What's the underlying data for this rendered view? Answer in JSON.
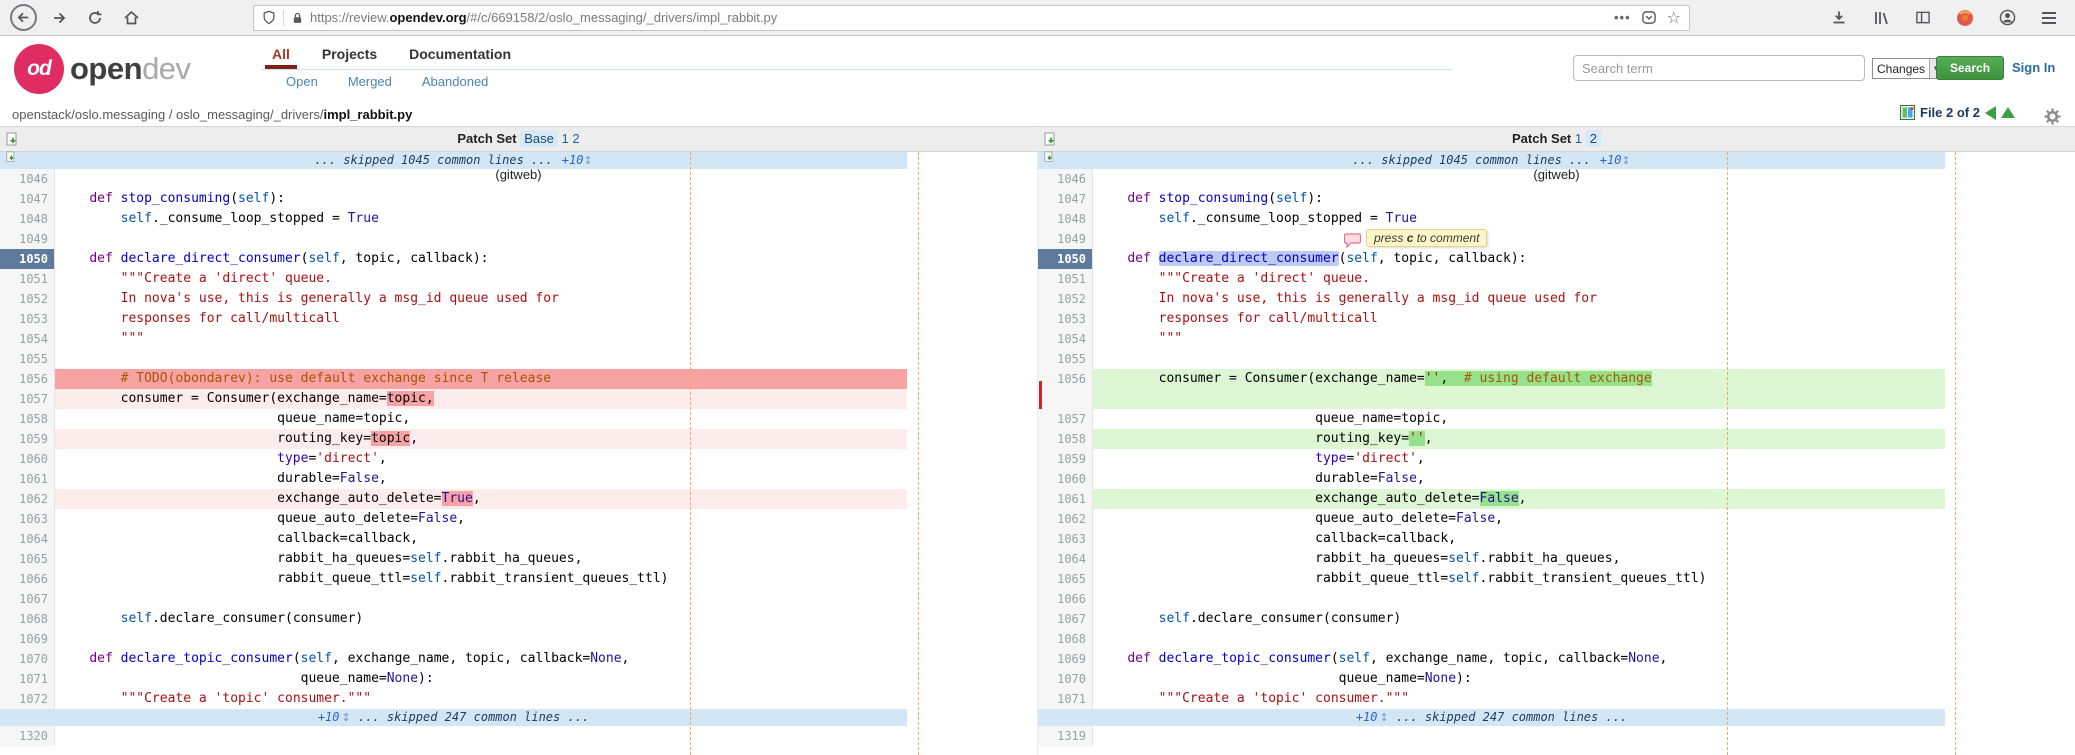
{
  "browser": {
    "url_scheme": "https://review.",
    "url_domain": "opendev.org",
    "url_path": "/#/c/669158/2/oslo_messaging/_drivers/impl_rabbit.py",
    "toolbar_icons": [
      "back",
      "forward",
      "reload",
      "home",
      "shield",
      "lock",
      "page-actions",
      "pocket",
      "bookmark-star",
      "download",
      "library",
      "sidebar",
      "privacy-badge",
      "account",
      "menu"
    ]
  },
  "header": {
    "logo_monogram": "od",
    "logo_bold": "open",
    "logo_light": "dev",
    "tabs": [
      {
        "label": "All",
        "active": true
      },
      {
        "label": "Projects",
        "active": false
      },
      {
        "label": "Documentation",
        "active": false
      }
    ],
    "subtabs": [
      {
        "label": "Open"
      },
      {
        "label": "Merged"
      },
      {
        "label": "Abandoned"
      }
    ],
    "search": {
      "placeholder": "Search term",
      "scope": "Changes",
      "button": "Search",
      "signin": "Sign In"
    }
  },
  "breadcrumb": {
    "prefix": "openstack/oslo.messaging / oslo_messaging/_drivers/",
    "file": "impl_rabbit.py"
  },
  "filenav": {
    "label": "File 2 of 2"
  },
  "left_header": {
    "label": "Patch Set",
    "base": "Base",
    "ps1": "1",
    "ps2": "2",
    "gitweb": "(gitweb)"
  },
  "right_header": {
    "label": "Patch Set",
    "ps1": "1",
    "ps2": "2",
    "gitweb": "(gitweb)"
  },
  "diff": {
    "skip_top": {
      "text": "... skipped 1045 common lines ...",
      "expand": "+10"
    },
    "skip_bottom": {
      "expand": "+10",
      "text": "... skipped 247 common lines ..."
    },
    "tooltip": {
      "pre": "press ",
      "key": "c",
      "post": " to comment"
    },
    "left_rows": [
      {
        "n": "1046",
        "t": ""
      },
      {
        "n": "1047",
        "t": "    def stop_consuming(self):"
      },
      {
        "n": "1048",
        "t": "        self._consume_loop_stopped = True"
      },
      {
        "n": "1049",
        "t": ""
      },
      {
        "n": "1050",
        "t": "    def declare_direct_consumer(self, topic, callback):",
        "cur": true
      },
      {
        "n": "1051",
        "t": "        \"\"\"Create a 'direct' queue."
      },
      {
        "n": "1052",
        "t": "        In nova's use, this is generally a msg_id queue used for"
      },
      {
        "n": "1053",
        "t": "        responses for call/multicall"
      },
      {
        "n": "1054",
        "t": "        \"\"\""
      },
      {
        "n": "1055",
        "t": ""
      },
      {
        "n": "1056",
        "t": "        # TODO(obondarev): use default exchange since T release",
        "bg": "del"
      },
      {
        "n": "1057",
        "t": "        consumer = Consumer(exchange_name=topic,",
        "bg": "delw",
        "mark": "topic,"
      },
      {
        "n": "1058",
        "t": "                            queue_name=topic,"
      },
      {
        "n": "1059",
        "t": "                            routing_key=topic,",
        "bg": "delw",
        "mark": "topic"
      },
      {
        "n": "1060",
        "t": "                            type='direct',"
      },
      {
        "n": "1061",
        "t": "                            durable=False,"
      },
      {
        "n": "1062",
        "t": "                            exchange_auto_delete=True,",
        "bg": "delw",
        "mark": "True"
      },
      {
        "n": "1063",
        "t": "                            queue_auto_delete=False,"
      },
      {
        "n": "1064",
        "t": "                            callback=callback,"
      },
      {
        "n": "1065",
        "t": "                            rabbit_ha_queues=self.rabbit_ha_queues,"
      },
      {
        "n": "1066",
        "t": "                            rabbit_queue_ttl=self.rabbit_transient_queues_ttl)"
      },
      {
        "n": "1067",
        "t": ""
      },
      {
        "n": "1068",
        "t": "        self.declare_consumer(consumer)"
      },
      {
        "n": "1069",
        "t": ""
      },
      {
        "n": "1070",
        "t": "    def declare_topic_consumer(self, exchange_name, topic, callback=None,"
      },
      {
        "n": "1071",
        "t": "                               queue_name=None):"
      },
      {
        "n": "1072",
        "t": "        \"\"\"Create a 'topic' consumer.\"\"\""
      }
    ],
    "right_rows": [
      {
        "n": "1046",
        "t": ""
      },
      {
        "n": "1047",
        "t": "    def stop_consuming(self):"
      },
      {
        "n": "1048",
        "t": "        self._consume_loop_stopped = True"
      },
      {
        "n": "1049",
        "t": ""
      },
      {
        "n": "1050",
        "t": "    def declare_direct_consumer(self, topic, callback):",
        "cur": true,
        "sel": "declare_direct_consumer"
      },
      {
        "n": "1051",
        "t": "        \"\"\"Create a 'direct' queue."
      },
      {
        "n": "1052",
        "t": "        In nova's use, this is generally a msg_id queue used for"
      },
      {
        "n": "1053",
        "t": "        responses for call/multicall"
      },
      {
        "n": "1054",
        "t": "        \"\"\""
      },
      {
        "n": "1055",
        "t": ""
      },
      {
        "n": "1056",
        "t": "        consumer = Consumer(exchange_name='',  # using default exchange",
        "bg": "ins",
        "mark": "'',  # using default exchange"
      },
      {
        "n": "",
        "t": "",
        "bg": "ins",
        "gap": true
      },
      {
        "n": "1057",
        "t": "                            queue_name=topic,"
      },
      {
        "n": "1058",
        "t": "                            routing_key='',",
        "bg": "ins",
        "mark": "''"
      },
      {
        "n": "1059",
        "t": "                            type='direct',"
      },
      {
        "n": "1060",
        "t": "                            durable=False,"
      },
      {
        "n": "1061",
        "t": "                            exchange_auto_delete=False,",
        "bg": "ins",
        "mark": "False"
      },
      {
        "n": "1062",
        "t": "                            queue_auto_delete=False,"
      },
      {
        "n": "1063",
        "t": "                            callback=callback,"
      },
      {
        "n": "1064",
        "t": "                            rabbit_ha_queues=self.rabbit_ha_queues,"
      },
      {
        "n": "1065",
        "t": "                            rabbit_queue_ttl=self.rabbit_transient_queues_ttl)"
      },
      {
        "n": "1066",
        "t": ""
      },
      {
        "n": "1067",
        "t": "        self.declare_consumer(consumer)"
      },
      {
        "n": "1068",
        "t": ""
      },
      {
        "n": "1069",
        "t": "    def declare_topic_consumer(self, exchange_name, topic, callback=None,"
      },
      {
        "n": "1070",
        "t": "                               queue_name=None):"
      },
      {
        "n": "1071",
        "t": "        \"\"\"Create a 'topic' consumer.\"\"\""
      }
    ],
    "bottom_left": {
      "n": "1320",
      "t": ""
    },
    "bottom_right": {
      "n": "1319",
      "t": ""
    }
  },
  "colors": {
    "brand": "#df2d63",
    "tab_active": "#a63a28",
    "link_blue": "#2061a8",
    "subnav_blue": "#4a88ad",
    "search_button_green": "#449a44",
    "skip_band": "#d3e6f6",
    "del_strong": "#f7a3a3",
    "del_weak": "#fdecec",
    "ins_strong": "#96e28a",
    "ins_weak": "#ddf6d3",
    "current_line_gutter": "#5f7b9c",
    "margin_line": "#f2a95f",
    "selection": "#bdc9f0",
    "caret": "#d42222",
    "tooltip_bg": "#fdf6cd"
  }
}
